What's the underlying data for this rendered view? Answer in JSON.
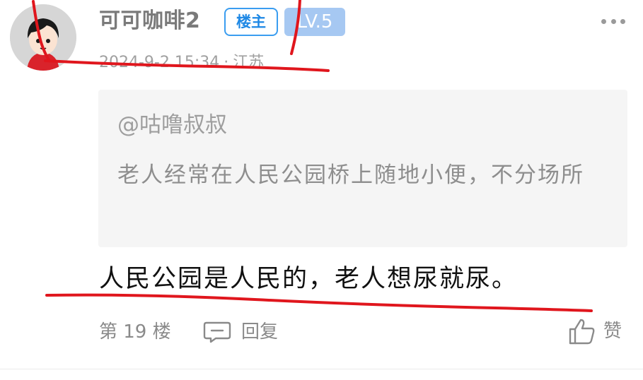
{
  "post": {
    "username": "可可咖啡2",
    "host_badge": "楼主",
    "level_badge": "LV.5",
    "timestamp": "2024-9-2 15:34",
    "separator": "·",
    "location": "江苏",
    "quote": {
      "author": "@咕噜叔叔",
      "text": "老人经常在人民公园桥上随地小便，不分场所"
    },
    "reply_text": "人民公园是人民的，老人想尿就尿。",
    "floor": "第 19 楼",
    "reply_label": "回复",
    "like_label": "赞"
  },
  "icons": {
    "more": "more-dots-icon",
    "reply": "comment-bubble-icon",
    "like": "thumbs-up-icon"
  },
  "colors": {
    "accent_blue": "#1e88e5",
    "level_badge_bg": "#a6c8f2",
    "annotation_red": "#e0161d",
    "quote_bg": "#f5f5f5"
  }
}
